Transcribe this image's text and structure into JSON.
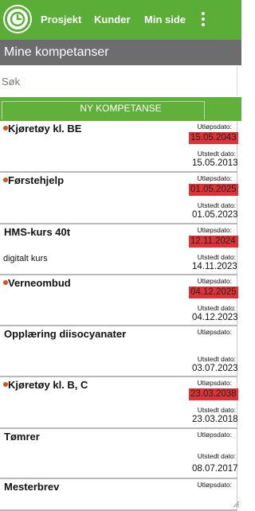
{
  "nav": {
    "home_icon": "clock-icon",
    "items": [
      "Prosjekt",
      "Kunder",
      "Min side"
    ],
    "menu_icon": "more-vertical-icon"
  },
  "page_title": "Mine kompetanser",
  "search": {
    "placeholder": "Søk",
    "value": ""
  },
  "new_button_label": "NY KOMPETANSE",
  "labels": {
    "expiry": "Utløpsdato:",
    "issued": "Utstedt dato:"
  },
  "colors": {
    "brand_green": "#5aad36",
    "expiry_red": "#e03236",
    "alert_dot": "#d2541c"
  },
  "competences": [
    {
      "name": "Kjøretøy kl. BE",
      "alert": true,
      "expiry": "15.05.2043",
      "issued": "15.05.2013",
      "description": ""
    },
    {
      "name": "Førstehjelp",
      "alert": true,
      "expiry": "01.05.2025",
      "issued": "01.05.2023",
      "description": ""
    },
    {
      "name": "HMS-kurs 40t",
      "alert": false,
      "expiry": "12.11.2024",
      "issued": "14.11.2023",
      "description": "digitalt kurs"
    },
    {
      "name": "Verneombud",
      "alert": true,
      "expiry": "04.12.2025",
      "issued": "04.12.2023",
      "description": ""
    },
    {
      "name": "Opplæring diisocyanater",
      "alert": false,
      "expiry": "",
      "issued": "03.07.2023",
      "description": ""
    },
    {
      "name": "Kjøretøy kl. B, C",
      "alert": true,
      "expiry": "23.03.2038",
      "issued": "23.03.2018",
      "description": ""
    },
    {
      "name": "Tømrer",
      "alert": false,
      "expiry": "",
      "issued": "08.07.2017",
      "description": ""
    },
    {
      "name": "Mesterbrev",
      "alert": false,
      "expiry": "",
      "issued": "",
      "description": ""
    }
  ]
}
